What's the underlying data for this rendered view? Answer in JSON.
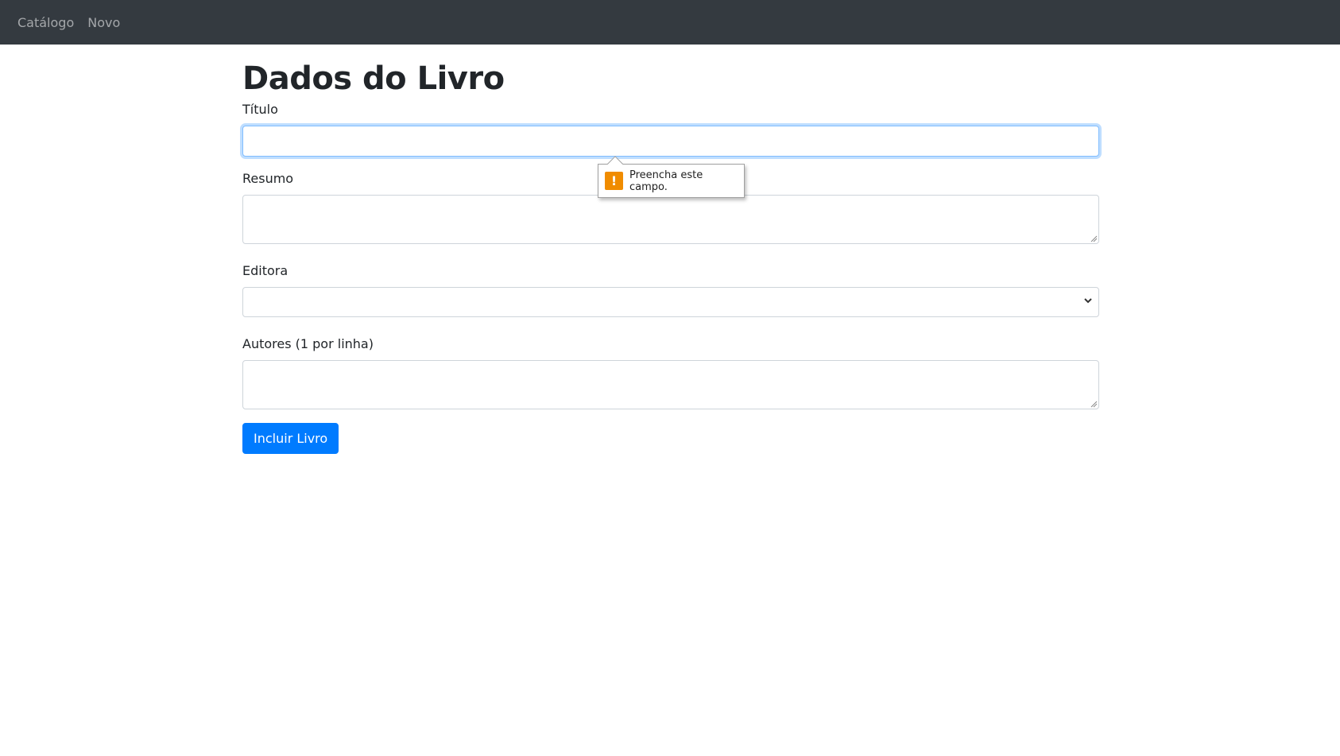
{
  "navbar": {
    "links": [
      "Catálogo",
      "Novo"
    ]
  },
  "page": {
    "title": "Dados do Livro"
  },
  "form": {
    "titulo_label": "Título",
    "titulo_value": "",
    "resumo_label": "Resumo",
    "resumo_value": "",
    "editora_label": "Editora",
    "editora_selected": "",
    "autores_label": "Autores (1 por linha)",
    "autores_value": "",
    "submit_label": "Incluir Livro"
  },
  "validation": {
    "message": "Preencha este campo.",
    "icon": "warning-icon",
    "icon_glyph": "!"
  },
  "colors": {
    "navbar_bg": "#343a40",
    "primary": "#007bff",
    "warning": "#f08c00"
  }
}
